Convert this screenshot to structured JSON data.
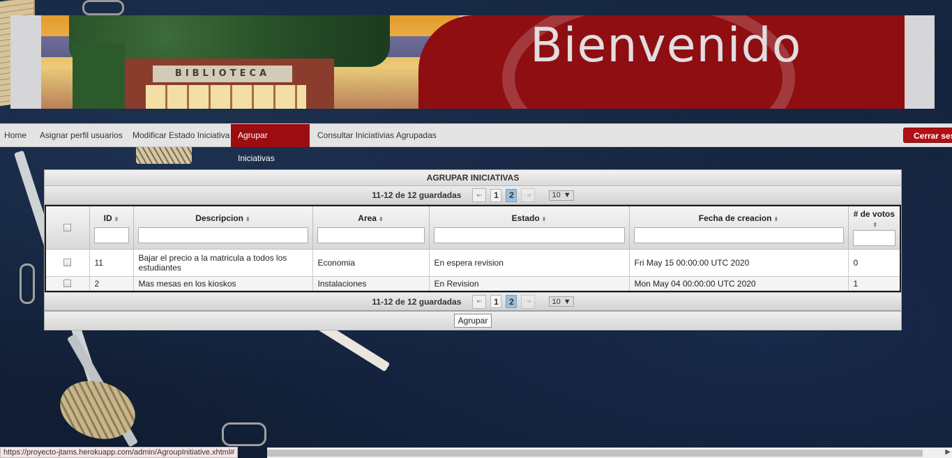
{
  "banner": {
    "title": "Bienvenido",
    "photo_sign": "BIBLIOTECA"
  },
  "nav": {
    "items": [
      {
        "label": "Home",
        "active": false
      },
      {
        "label": "Asignar perfil usuarios",
        "active": false
      },
      {
        "label": "Modificar Estado Iniciativa",
        "active": false
      },
      {
        "label": "Agrupar Iniciativas",
        "active": true
      },
      {
        "label": "Consultar Iniciativias Agrupadas",
        "active": false
      }
    ],
    "logout_label": "Cerrar ses"
  },
  "panel": {
    "title": "AGRUPAR INICIATIVAS",
    "paginator": {
      "report": "11-12 de 12 guardadas",
      "pages": [
        "1",
        "2"
      ],
      "current_page": "2",
      "rows_per_page": "10"
    },
    "columns": {
      "id": "ID",
      "descripcion": "Descripcion",
      "area": "Area",
      "estado": "Estado",
      "fecha": "Fecha de creacion",
      "votos": "# de votos"
    },
    "rows": [
      {
        "id": "11",
        "descripcion": "Bajar el precio a la matricula a todos los estudiantes",
        "area": "Economia",
        "estado": "En espera revision",
        "fecha": "Fri May 15 00:00:00 UTC 2020",
        "votos": "0"
      },
      {
        "id": "2",
        "descripcion": "Mas mesas en los kioskos",
        "area": "Instalaciones",
        "estado": "En Revision",
        "fecha": "Mon May 04 00:00:00 UTC 2020",
        "votos": "1"
      }
    ],
    "submit_label": "Agrupar"
  },
  "status_bar": {
    "url": "https://proyecto-jtams.herokuapp.com/admin/AgroupInitiative.xhtml#"
  },
  "colors": {
    "accent_red": "#9b0d10",
    "selected_page": "#9cc0dc"
  }
}
